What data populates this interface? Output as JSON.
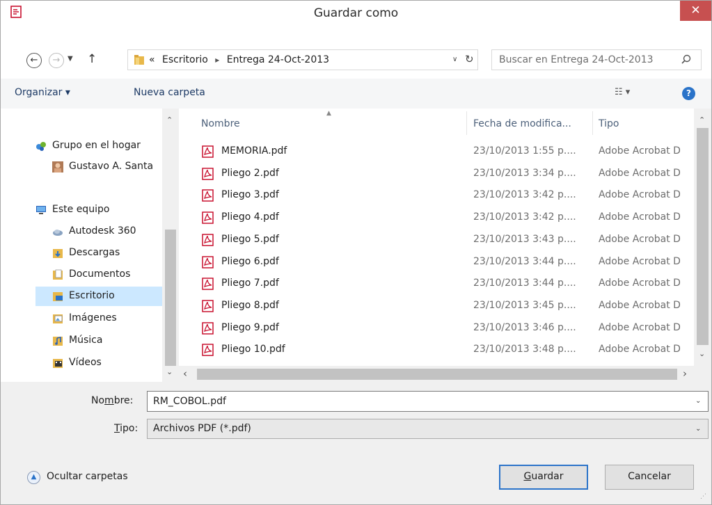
{
  "window": {
    "title": "Guardar como",
    "close_label": "✕"
  },
  "nav": {
    "back_glyph": "←",
    "forward_glyph": "→",
    "recent_glyph": "▼",
    "up_glyph": "↑",
    "address": {
      "overflow": "«",
      "segments": [
        "Escritorio",
        "Entrega 24-Oct-2013"
      ],
      "separator": "▸",
      "dropdown_glyph": "∨",
      "refresh_glyph": "↻"
    },
    "search": {
      "placeholder": "Buscar en Entrega 24-Oct-2013"
    }
  },
  "toolbar": {
    "organize_label": "Organizar ▾",
    "new_folder_label": "Nueva carpeta",
    "view_glyph": "☷ ▾",
    "help_glyph": "?"
  },
  "sidebar": {
    "items": [
      {
        "label": "Grupo en el hogar",
        "icon": "homegroup-icon"
      },
      {
        "label": "Gustavo A. Santa",
        "icon": "user-avatar-icon"
      },
      {
        "label": "Este equipo",
        "icon": "computer-icon"
      },
      {
        "label": "Autodesk 360",
        "icon": "cloud-icon"
      },
      {
        "label": "Descargas",
        "icon": "downloads-folder-icon"
      },
      {
        "label": "Documentos",
        "icon": "documents-folder-icon"
      },
      {
        "label": "Escritorio",
        "icon": "desktop-folder-icon",
        "selected": true
      },
      {
        "label": "Imágenes",
        "icon": "pictures-folder-icon"
      },
      {
        "label": "Música",
        "icon": "music-folder-icon"
      },
      {
        "label": "Vídeos",
        "icon": "videos-folder-icon"
      }
    ]
  },
  "filelist": {
    "columns": [
      "Nombre",
      "Fecha de modifica...",
      "Tipo"
    ],
    "rows": [
      {
        "name": "MEMORIA.pdf",
        "date": "23/10/2013 1:55 p....",
        "type": "Adobe Acrobat D"
      },
      {
        "name": "Pliego 2.pdf",
        "date": "23/10/2013 3:34 p....",
        "type": "Adobe Acrobat D"
      },
      {
        "name": "Pliego 3.pdf",
        "date": "23/10/2013 3:42 p....",
        "type": "Adobe Acrobat D"
      },
      {
        "name": "Pliego 4.pdf",
        "date": "23/10/2013 3:42 p....",
        "type": "Adobe Acrobat D"
      },
      {
        "name": "Pliego 5.pdf",
        "date": "23/10/2013 3:43 p....",
        "type": "Adobe Acrobat D"
      },
      {
        "name": "Pliego 6.pdf",
        "date": "23/10/2013 3:44 p....",
        "type": "Adobe Acrobat D"
      },
      {
        "name": "Pliego 7.pdf",
        "date": "23/10/2013 3:44 p....",
        "type": "Adobe Acrobat D"
      },
      {
        "name": "Pliego 8.pdf",
        "date": "23/10/2013 3:45 p....",
        "type": "Adobe Acrobat D"
      },
      {
        "name": "Pliego 9.pdf",
        "date": "23/10/2013 3:46 p....",
        "type": "Adobe Acrobat D"
      },
      {
        "name": "Pliego 10.pdf",
        "date": "23/10/2013 3:48 p....",
        "type": "Adobe Acrobat D"
      }
    ]
  },
  "form": {
    "name_label_pre": "No",
    "name_label_ul": "m",
    "name_label_post": "bre:",
    "name_value": "RM_COBOL.pdf",
    "type_label_ul": "T",
    "type_label_post": "ipo:",
    "type_value": "Archivos PDF (*.pdf)"
  },
  "footer": {
    "hide_folders_label": "Ocultar carpetas",
    "save_ul": "G",
    "save_rest": "uardar",
    "cancel_label": "Cancelar"
  },
  "colors": {
    "accent": "#2a73c9",
    "close": "#c75050",
    "selection": "#cce8ff",
    "pdf_red": "#c8102e"
  }
}
